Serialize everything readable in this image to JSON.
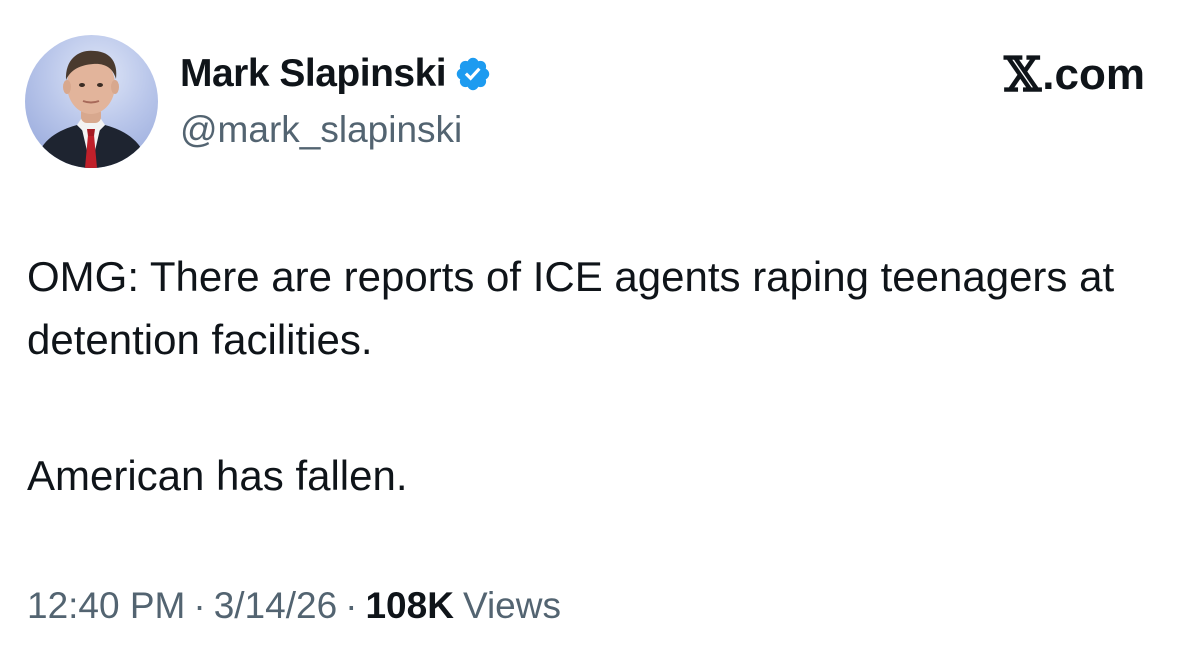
{
  "author": {
    "name": "Mark Slapinski",
    "handle": "@mark_slapinski",
    "verified": true,
    "avatar_icon": "profile-photo",
    "verified_color": "#1d9bf0"
  },
  "brand": {
    "logo_glyph": "𝕏",
    "suffix": ".com"
  },
  "tweet": {
    "paragraphs": [
      "OMG: There are reports of ICE agents raping teenagers at detention facilities.",
      "American has fallen."
    ]
  },
  "meta": {
    "time": "12:40 PM",
    "separator": "·",
    "date": "3/14/26",
    "views_count": "108K",
    "views_label": "Views"
  },
  "colors": {
    "text": "#0f1419",
    "secondary": "#536471",
    "accent": "#1d9bf0"
  }
}
